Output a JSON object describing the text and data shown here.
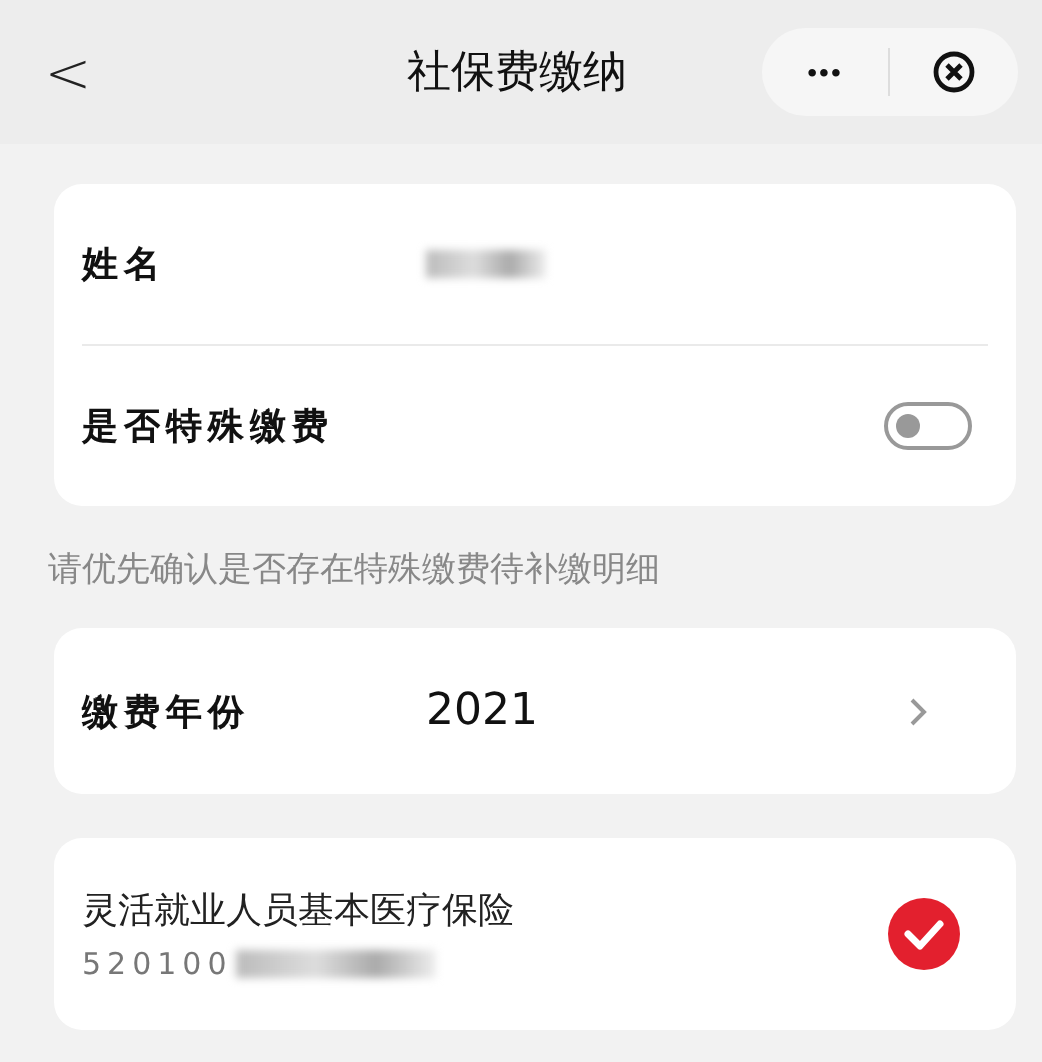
{
  "header": {
    "back": "<",
    "title": "社保费缴纳",
    "more": "•••"
  },
  "person": {
    "name_label": "姓名",
    "name_redacted": true,
    "special_label": "是否特殊缴费",
    "special_on": false
  },
  "note": "请优先确认是否存在特殊缴费待补缴明细",
  "year": {
    "label": "缴费年份",
    "value": "2021"
  },
  "insurance": [
    {
      "name": "灵活就业人员基本医疗保险",
      "number": "520100",
      "number_redacted": true,
      "checked": true
    }
  ]
}
